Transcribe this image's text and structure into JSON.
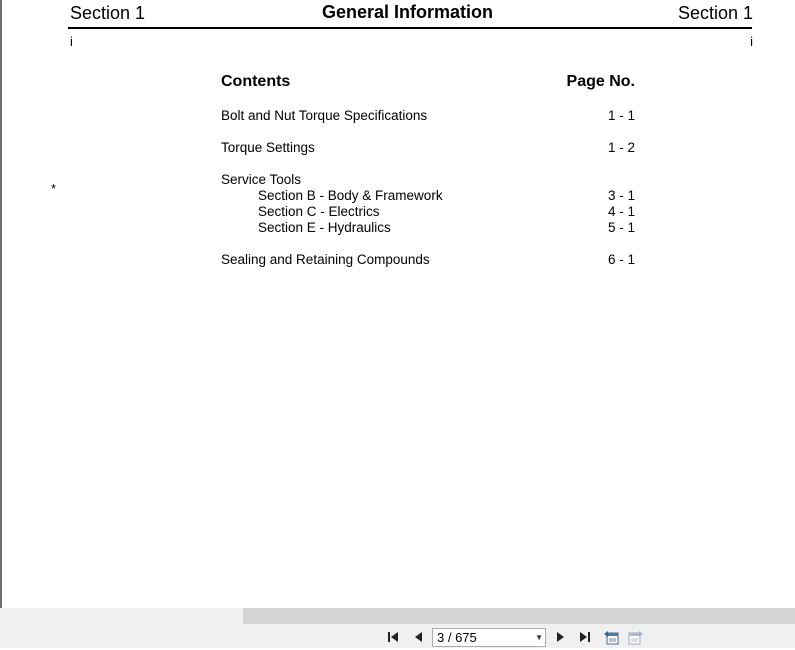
{
  "document": {
    "header_left": "Section 1",
    "header_title": "General Information",
    "header_right": "Section 1",
    "page_marker_left": "i",
    "page_marker_right": "i",
    "margin_star": "*"
  },
  "toc": {
    "heading": "Contents",
    "page_heading": "Page No.",
    "rows": [
      {
        "label": "Bolt and Nut Torque Specifications",
        "page": "1 - 1"
      },
      {
        "label": "Torque Settings",
        "page": "1 - 2"
      },
      {
        "label": "Service Tools",
        "page": ""
      },
      {
        "label": "Section B - Body & Framework",
        "page": "3 - 1"
      },
      {
        "label": "Section C - Electrics",
        "page": "4 - 1"
      },
      {
        "label": "Section E - Hydraulics",
        "page": "5 - 1"
      },
      {
        "label": "Sealing and Retaining Compounds",
        "page": "6 - 1"
      }
    ]
  },
  "viewer": {
    "page_indicator": "3 / 675",
    "icons": [
      "first-page-icon",
      "previous-page-icon",
      "next-page-icon",
      "last-page-icon",
      "prev-view-icon",
      "next-view-icon"
    ]
  }
}
